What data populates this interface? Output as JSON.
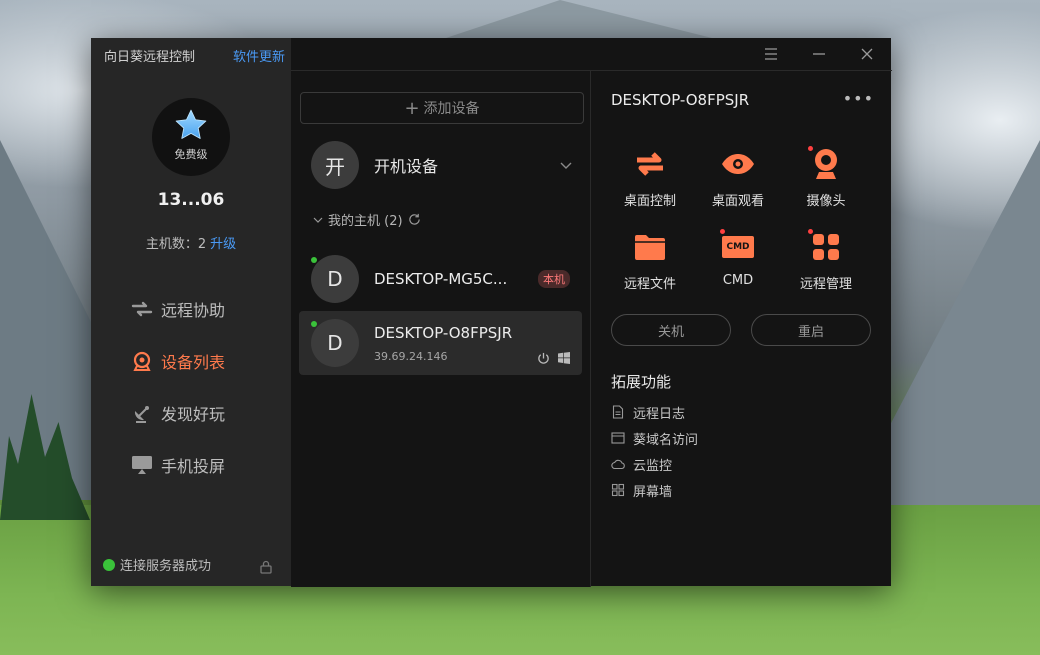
{
  "app": {
    "title": "向日葵远程控制",
    "update_link": "软件更新"
  },
  "profile": {
    "level": "免费级",
    "user_id": "13...06",
    "host_count_label": "主机数：2",
    "upgrade_label": "升级"
  },
  "nav": {
    "items": [
      {
        "label": "远程协助",
        "icon": "swap-arrows-icon"
      },
      {
        "label": "设备列表",
        "icon": "location-pin-icon",
        "active": true
      },
      {
        "label": "发现好玩",
        "icon": "satellite-dish-icon"
      },
      {
        "label": "手机投屏",
        "icon": "cast-screen-icon"
      }
    ]
  },
  "status": {
    "text": "连接服务器成功",
    "color": "#3ac23a"
  },
  "middle": {
    "add_device_label": "添加设备",
    "boot_avatar": "开",
    "boot_label": "开机设备",
    "my_hosts_label": "我的主机 (2)",
    "devices": [
      {
        "avatar": "D",
        "name": "DESKTOP-MG5C...",
        "badge": "本机",
        "online": true
      },
      {
        "avatar": "D",
        "name": "DESKTOP-O8FPSJR",
        "ip": "39.69.24.146",
        "online": true,
        "selected": true
      }
    ]
  },
  "detail": {
    "device_name": "DESKTOP-O8FPSJR",
    "more_label": "•••",
    "tools": [
      {
        "label": "桌面控制",
        "icon": "desktop-control-icon"
      },
      {
        "label": "桌面观看",
        "icon": "eye-icon"
      },
      {
        "label": "摄像头",
        "icon": "webcam-icon"
      },
      {
        "label": "远程文件",
        "icon": "folder-icon"
      },
      {
        "label": "CMD",
        "icon": "cmd-icon",
        "icon_text": "CMD"
      },
      {
        "label": "远程管理",
        "icon": "grid-manage-icon"
      }
    ],
    "shutdown_label": "关机",
    "restart_label": "重启",
    "extensions_title": "拓展功能",
    "extensions": [
      {
        "label": "远程日志",
        "icon": "document-icon"
      },
      {
        "label": "葵域名访问",
        "icon": "browser-window-icon"
      },
      {
        "label": "云监控",
        "icon": "cloud-icon"
      },
      {
        "label": "屏幕墙",
        "icon": "grid-icon"
      }
    ]
  },
  "colors": {
    "accent": "#ff7a4c",
    "link": "#4a9af5",
    "online": "#3ac23a"
  }
}
